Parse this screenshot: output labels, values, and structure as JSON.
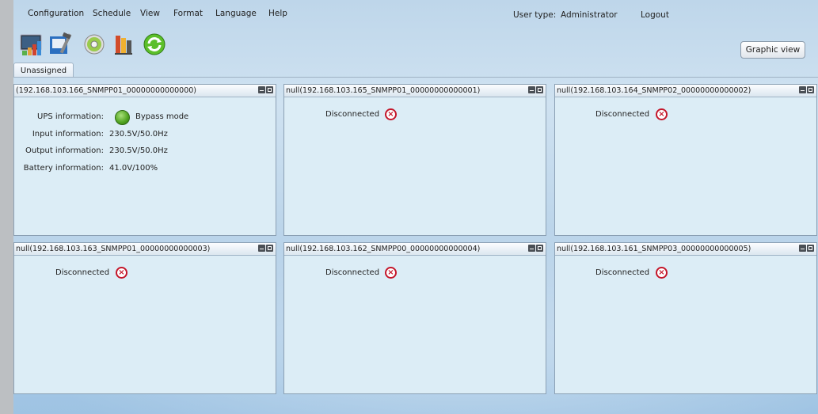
{
  "menu": [
    "Configuration",
    "Schedule",
    "View",
    "Format",
    "Language",
    "Help"
  ],
  "header": {
    "user_type_label": "User type:",
    "user_type_value": "Administrator",
    "logout": "Logout"
  },
  "toolbar": {
    "icons": [
      "monitor-icon",
      "tools-icon",
      "disc-icon",
      "battery-icon",
      "refresh-icon"
    ],
    "graphic_view": "Graphic view"
  },
  "tabs": [
    "Unassigned"
  ],
  "panels": [
    {
      "title": "(192.168.103.166_SNMPP01_00000000000000)",
      "ups_label": "UPS information:",
      "ups_value": "Bypass mode",
      "input_label": "Input information:",
      "input_value": "230.5V/50.0Hz",
      "output_label": "Output information:",
      "output_value": "230.5V/50.0Hz",
      "battery_label": "Battery information:",
      "battery_value": "41.0V/100%"
    },
    {
      "title": "null(192.168.103.165_SNMPP01_00000000000001)",
      "status": "Disconnected"
    },
    {
      "title": "null(192.168.103.164_SNMPP02_00000000000002)",
      "status": "Disconnected"
    },
    {
      "title": "null(192.168.103.163_SNMPP01_00000000000003)",
      "status": "Disconnected"
    },
    {
      "title": "null(192.168.103.162_SNMPP00_00000000000004)",
      "status": "Disconnected"
    },
    {
      "title": "null(192.168.103.161_SNMPP03_00000000000005)",
      "status": "Disconnected"
    }
  ],
  "colors": {
    "panel_bg": "#dcedf6",
    "status_ok": "#4ea21e",
    "status_error": "#c4162a"
  }
}
